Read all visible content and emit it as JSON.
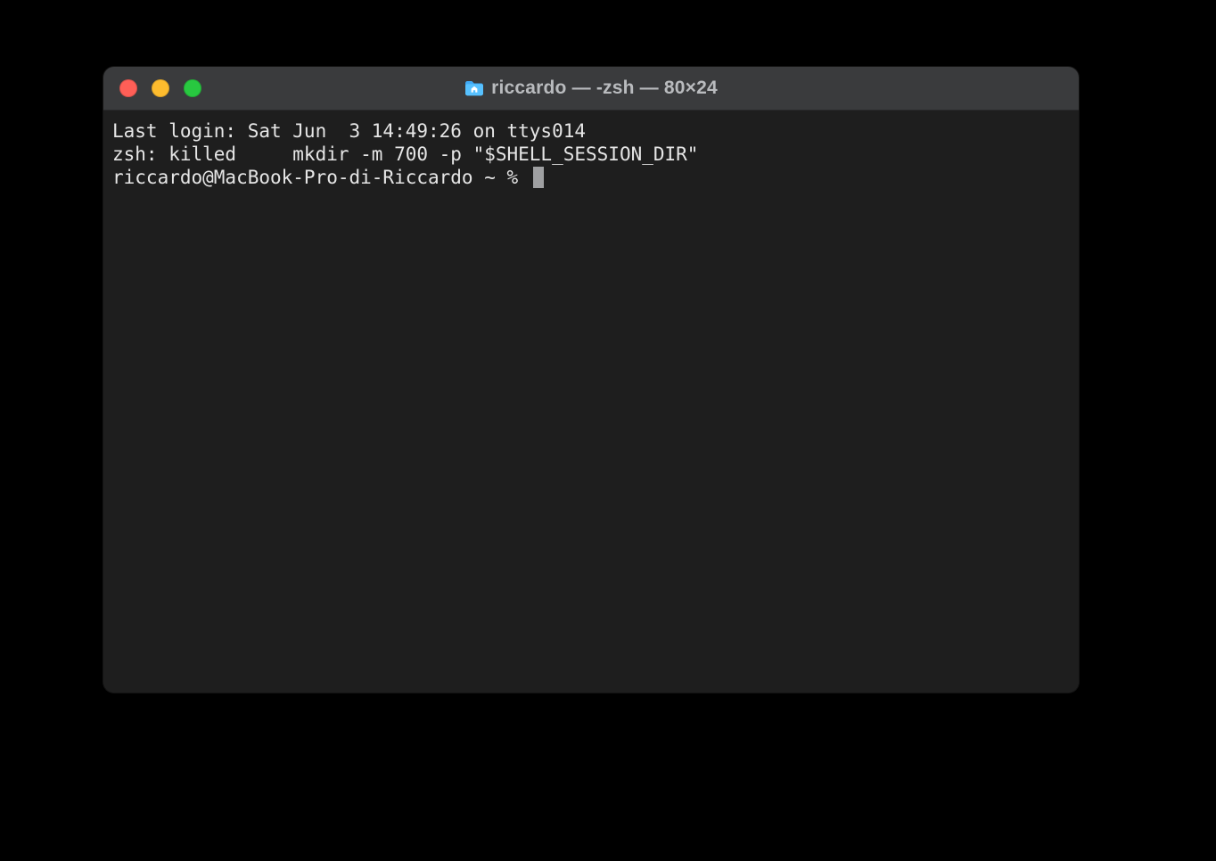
{
  "window": {
    "title": "riccardo — -zsh — 80×24"
  },
  "terminal": {
    "line1": "Last login: Sat Jun  3 14:49:26 on ttys014",
    "line2": "zsh: killed     mkdir -m 700 -p \"$SHELL_SESSION_DIR\"",
    "prompt": "riccardo@MacBook-Pro-di-Riccardo ~ % "
  }
}
